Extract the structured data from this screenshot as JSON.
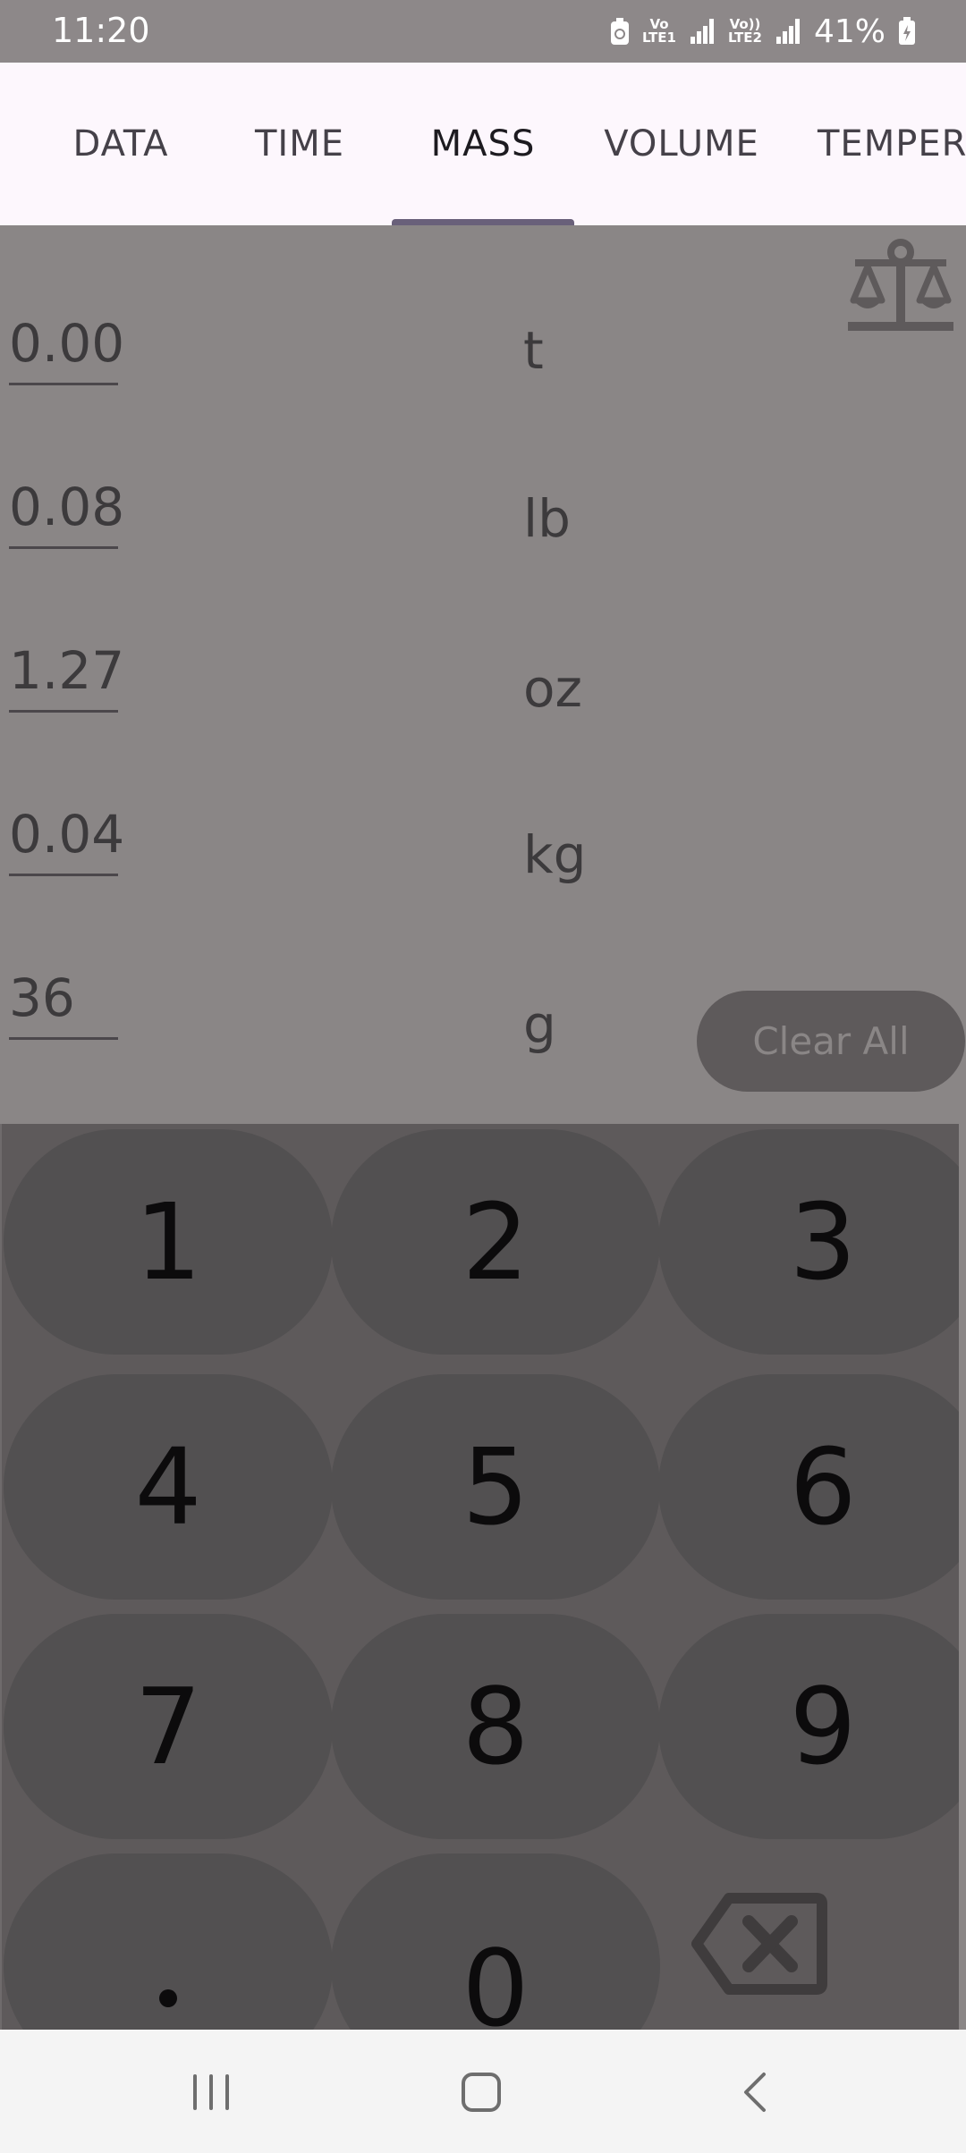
{
  "status_bar": {
    "time": "11:20",
    "sim1_top": "Vo",
    "sim1_bottom": "LTE1",
    "sim2_top": "Vo))",
    "sim2_bottom": "LTE2",
    "battery": "41%"
  },
  "tabs": [
    {
      "label": "DATA",
      "active": false
    },
    {
      "label": "TIME",
      "active": false
    },
    {
      "label": "MASS",
      "active": true
    },
    {
      "label": "VOLUME",
      "active": false
    },
    {
      "label": "TEMPER",
      "active": false
    }
  ],
  "conversions": [
    {
      "value": "0.00",
      "unit": "t"
    },
    {
      "value": "0.08",
      "unit": "lb"
    },
    {
      "value": "1.27",
      "unit": "oz"
    },
    {
      "value": "0.04",
      "unit": "kg"
    },
    {
      "value": "36",
      "unit": "g"
    }
  ],
  "clear_all_label": "Clear All",
  "keypad": {
    "keys": [
      "1",
      "2",
      "3",
      "4",
      "5",
      "6",
      "7",
      "8",
      "9",
      ".",
      "0"
    ],
    "backspace_icon": "backspace-icon"
  },
  "icons": {
    "category": "scale-balance-icon",
    "nav": [
      "recents-icon",
      "home-icon",
      "back-icon"
    ]
  },
  "colors": {
    "overlay": "#8a8686",
    "tab_bar": "#fdf7fd",
    "indicator": "#69607a",
    "keypad_bg": "#5e5a5b",
    "key_bg": "#525051"
  }
}
